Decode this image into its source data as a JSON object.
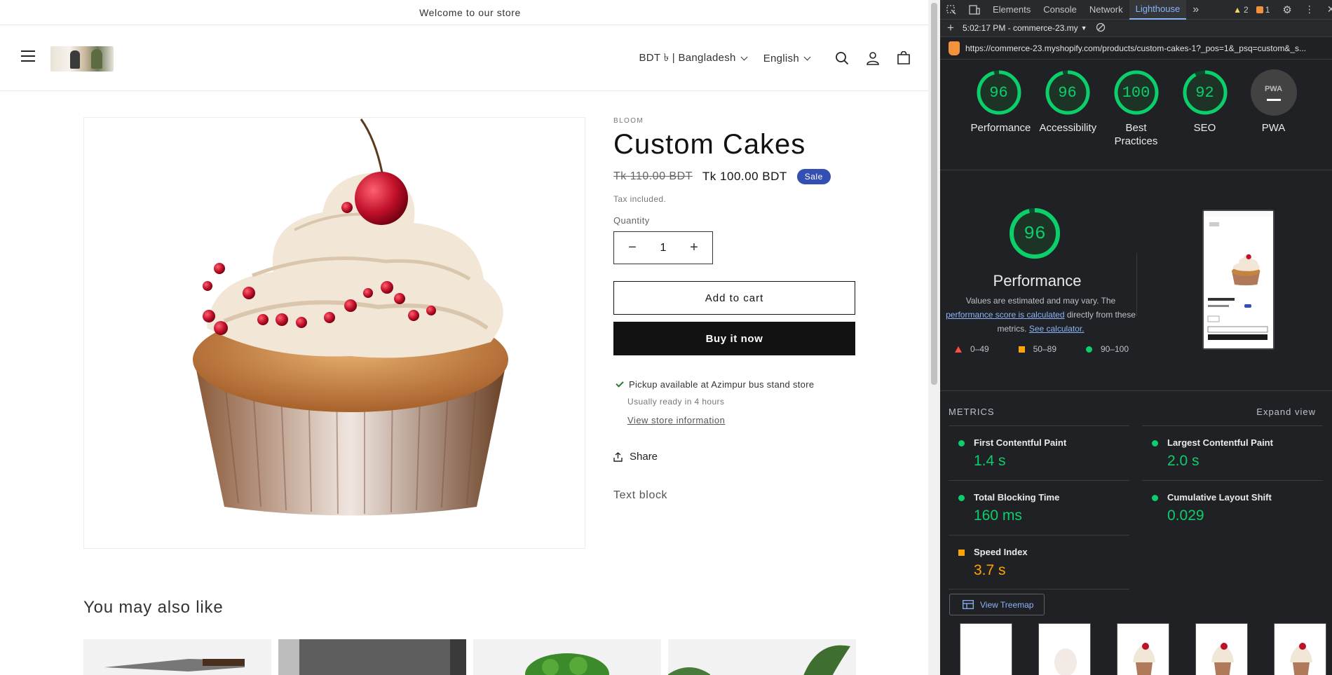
{
  "store": {
    "announcement": "Welcome to our store",
    "header": {
      "currency": "BDT ৳ | Bangladesh",
      "language": "English"
    },
    "product": {
      "vendor": "BLOOM",
      "title": "Custom Cakes",
      "price_old": "Tk 110.00 BDT",
      "price_new": "Tk 100.00 BDT",
      "sale_badge": "Sale",
      "tax_note": "Tax included.",
      "quantity_label": "Quantity",
      "quantity_value": "1",
      "qty_minus": "−",
      "qty_plus": "+",
      "add_to_cart": "Add to cart",
      "buy_now": "Buy it now",
      "pickup_prefix": "Pickup available at ",
      "pickup_store": "Azimpur bus stand store",
      "pickup_time": "Usually ready in 4 hours",
      "store_info_link": "View store information",
      "share": "Share",
      "text_block": "Text block"
    },
    "also_like_heading": "You may also like"
  },
  "devtools": {
    "tabs": [
      "Elements",
      "Console",
      "Network",
      "Lighthouse"
    ],
    "active_tab": "Lighthouse",
    "warnings_count": "2",
    "issues_count": "1",
    "report_time": "5:02:17 PM - commerce-23.my",
    "url": "https://commerce-23.myshopify.com/products/custom-cakes-1?_pos=1&_psq=custom&_s...",
    "scores": [
      {
        "label": "Performance",
        "value": "96"
      },
      {
        "label": "Accessibility",
        "value": "96"
      },
      {
        "label": "Best Practices",
        "value": "100"
      },
      {
        "label": "SEO",
        "value": "92"
      }
    ],
    "pwa_label": "PWA",
    "pwa_badge": "PWA",
    "performance": {
      "score": "96",
      "title": "Performance",
      "desc_1": "Values are estimated and may vary. The",
      "desc_link1": "performance score is calculated",
      "desc_2": " directly from these metrics. ",
      "desc_link2": "See calculator.",
      "legend_fail": "0–49",
      "legend_average": "50–89",
      "legend_pass": "90–100"
    },
    "metrics_heading": "METRICS",
    "expand_view": "Expand view",
    "metrics": [
      {
        "name": "First Contentful Paint",
        "value": "1.4 s",
        "status": "pass"
      },
      {
        "name": "Largest Contentful Paint",
        "value": "2.0 s",
        "status": "pass"
      },
      {
        "name": "Total Blocking Time",
        "value": "160 ms",
        "status": "pass"
      },
      {
        "name": "Cumulative Layout Shift",
        "value": "0.029",
        "status": "pass"
      },
      {
        "name": "Speed Index",
        "value": "3.7 s",
        "status": "average"
      }
    ],
    "view_treemap": "View Treemap",
    "colors": {
      "pass": "#0cce6b",
      "average": "#ffa400",
      "fail": "#ff4e42",
      "link": "#8ab4f8"
    }
  }
}
